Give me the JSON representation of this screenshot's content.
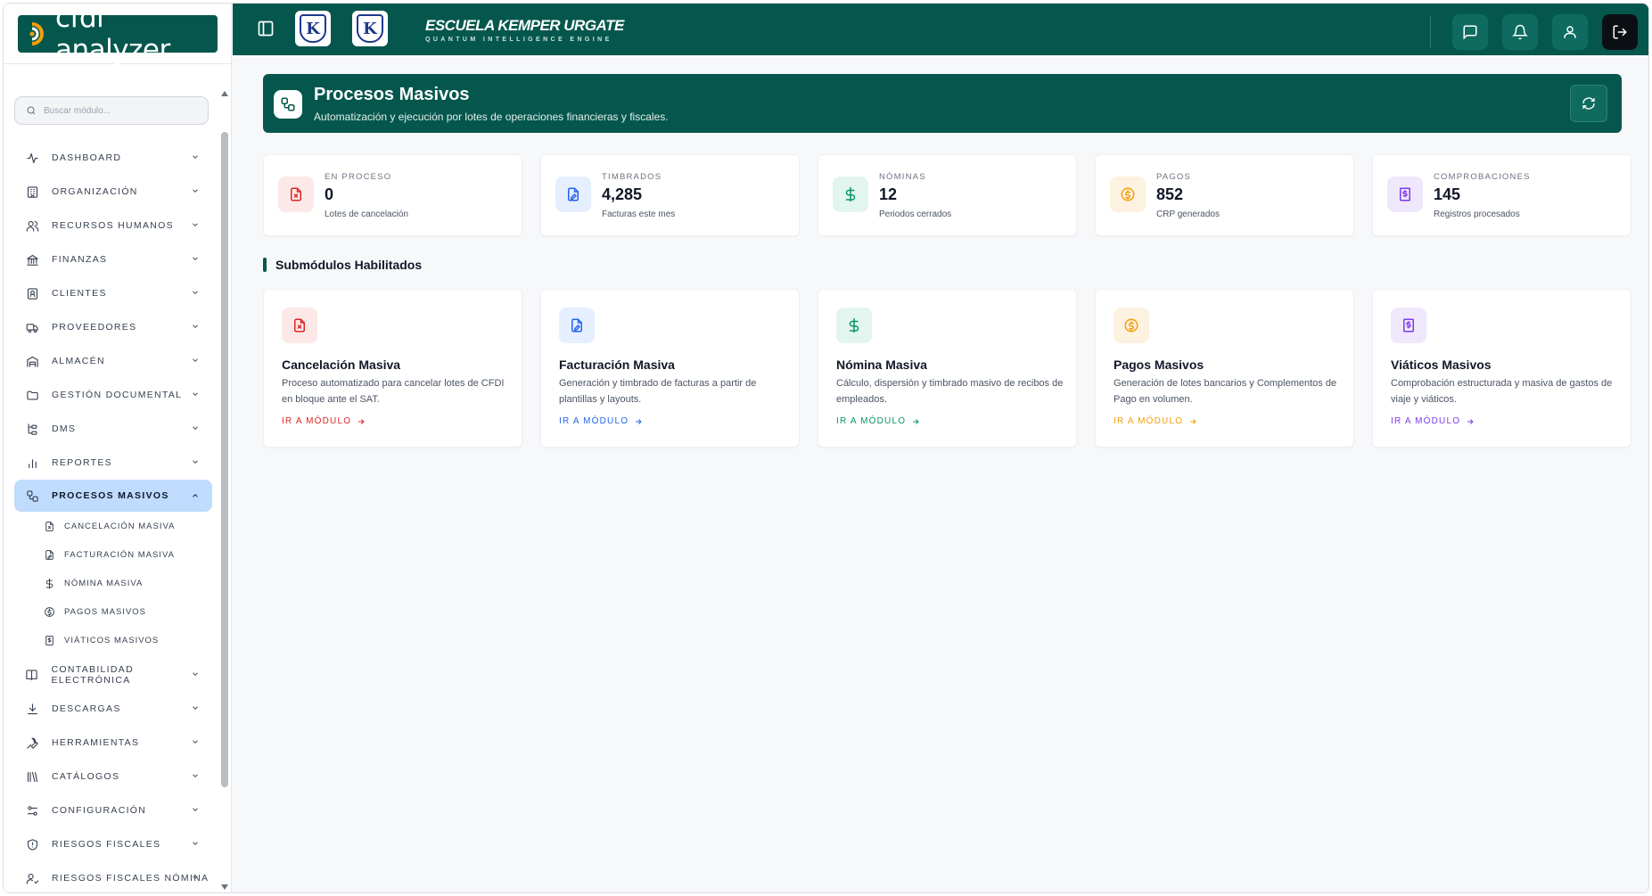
{
  "app": {
    "logo_text": "cfdi analyzer"
  },
  "search": {
    "placeholder": "Buscar módulo..."
  },
  "header": {
    "school_name": "ESCUELA KEMPER URGATE",
    "school_tagline": "QUANTUM INTELLIGENCE ENGINE",
    "logo_letter": "K"
  },
  "nav": [
    {
      "label": "DASHBOARD",
      "icon": "activity-icon"
    },
    {
      "label": "ORGANIZACIÓN",
      "icon": "building-icon"
    },
    {
      "label": "RECURSOS HUMANOS",
      "icon": "users-icon"
    },
    {
      "label": "FINANZAS",
      "icon": "bank-icon"
    },
    {
      "label": "CLIENTES",
      "icon": "contact-icon"
    },
    {
      "label": "PROVEEDORES",
      "icon": "truck-icon"
    },
    {
      "label": "ALMACÉN",
      "icon": "warehouse-icon"
    },
    {
      "label": "GESTIÓN DOCUMENTAL",
      "icon": "folder-icon"
    },
    {
      "label": "DMS",
      "icon": "tree-icon"
    },
    {
      "label": "REPORTES",
      "icon": "bar-chart-icon"
    },
    {
      "label": "PROCESOS MASIVOS",
      "icon": "workflow-icon",
      "active": true
    },
    {
      "label": "CONTABILIDAD ELECTRÓNICA",
      "icon": "book-icon"
    },
    {
      "label": "DESCARGAS",
      "icon": "download-icon"
    },
    {
      "label": "HERRAMIENTAS",
      "icon": "wrench-icon"
    },
    {
      "label": "CATÁLOGOS",
      "icon": "library-icon"
    },
    {
      "label": "CONFIGURACIÓN",
      "icon": "sliders-icon"
    },
    {
      "label": "RIESGOS FISCALES",
      "icon": "shield-icon"
    },
    {
      "label": "RIESGOS FISCALES NÓMINA",
      "icon": "user-check-icon"
    }
  ],
  "subnav": [
    {
      "label": "CANCELACIÓN MASIVA",
      "icon": "file-x-icon"
    },
    {
      "label": "FACTURACIÓN MASIVA",
      "icon": "file-signature-icon"
    },
    {
      "label": "NÓMINA MASIVA",
      "icon": "dollar-icon"
    },
    {
      "label": "PAGOS MASIVOS",
      "icon": "coin-icon"
    },
    {
      "label": "VIÁTICOS MASIVOS",
      "icon": "receipt-icon"
    }
  ],
  "hero": {
    "title": "Procesos Masivos",
    "subtitle": "Automatización y ejecución por lotes de operaciones financieras y fiscales."
  },
  "stats": [
    {
      "label": "EN PROCESO",
      "value": "0",
      "note": "Lotes de cancelación",
      "color": "#dc2626",
      "bg": "#fde8e8",
      "icon": "file-x-icon"
    },
    {
      "label": "TIMBRADOS",
      "value": "4,285",
      "note": "Facturas este mes",
      "color": "#2563eb",
      "bg": "#e6efff",
      "icon": "file-signature-icon"
    },
    {
      "label": "NÓMINAS",
      "value": "12",
      "note": "Periodos cerrados",
      "color": "#059669",
      "bg": "#e3f6ee",
      "icon": "dollar-icon"
    },
    {
      "label": "PAGOS",
      "value": "852",
      "note": "CRP generados",
      "color": "#f59e0b",
      "bg": "#fdf2df",
      "icon": "coin-icon"
    },
    {
      "label": "COMPROBACIONES",
      "value": "145",
      "note": "Registros procesados",
      "color": "#7c3aed",
      "bg": "#efe8fc",
      "icon": "receipt-icon"
    }
  ],
  "section": {
    "title": "Submódulos Habilitados"
  },
  "cards": [
    {
      "title": "Cancelación Masiva",
      "desc": "Proceso automatizado para cancelar lotes de CFDI en bloque ante el SAT.",
      "link": "IR A MÓDULO",
      "color": "#dc2626",
      "bg": "#fde8e8",
      "icon": "file-x-icon"
    },
    {
      "title": "Facturación Masiva",
      "desc": "Generación y timbrado de facturas a partir de plantillas y layouts.",
      "link": "IR A MÓDULO",
      "color": "#2563eb",
      "bg": "#e6efff",
      "icon": "file-signature-icon"
    },
    {
      "title": "Nómina Masiva",
      "desc": "Cálculo, dispersión y timbrado masivo de recibos de empleados.",
      "link": "IR A MÓDULO",
      "color": "#059669",
      "bg": "#e3f6ee",
      "icon": "dollar-icon"
    },
    {
      "title": "Pagos Masivos",
      "desc": "Generación de lotes bancarios y Complementos de Pago en volumen.",
      "link": "IR A MÓDULO",
      "color": "#f59e0b",
      "bg": "#fdf2df",
      "icon": "coin-icon"
    },
    {
      "title": "Viáticos Masivos",
      "desc": "Comprobación estructurada y masiva de gastos de viaje y viáticos.",
      "link": "IR A MÓDULO",
      "color": "#7c3aed",
      "bg": "#efe8fc",
      "icon": "receipt-icon"
    }
  ]
}
